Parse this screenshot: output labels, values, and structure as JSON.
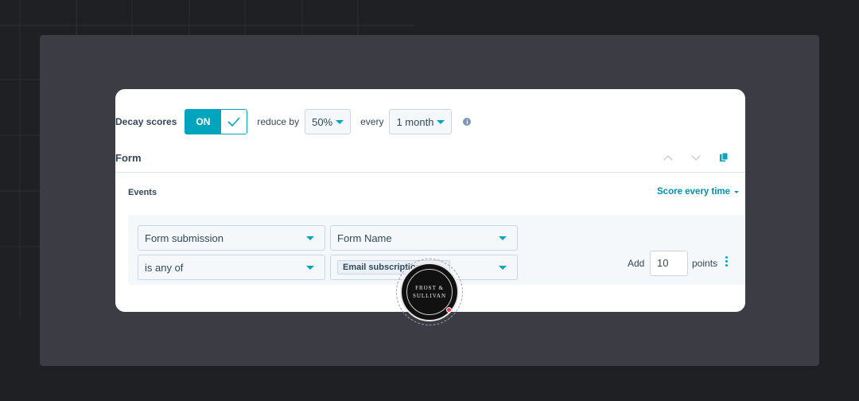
{
  "decay": {
    "label": "Decay scores",
    "toggle_label": "ON",
    "reduce_by_label": "reduce by",
    "reduce_by_value": "50%",
    "every_label": "every",
    "every_value": "1 month",
    "info_icon": "i"
  },
  "form_section": {
    "title": "Form"
  },
  "events": {
    "label": "Events",
    "score_mode": "Score every time"
  },
  "rule": {
    "event_type": "Form submission",
    "property": "Form Name",
    "operator": "is any of",
    "value_tag": "Email subscription",
    "add_label": "Add",
    "points_value": "10",
    "points_label": "points"
  },
  "badge": {
    "line1": "FROST &",
    "line2": "SULLIVAN"
  },
  "colors": {
    "accent": "#00a4bd",
    "link": "#0091ae",
    "text": "#33475b"
  }
}
